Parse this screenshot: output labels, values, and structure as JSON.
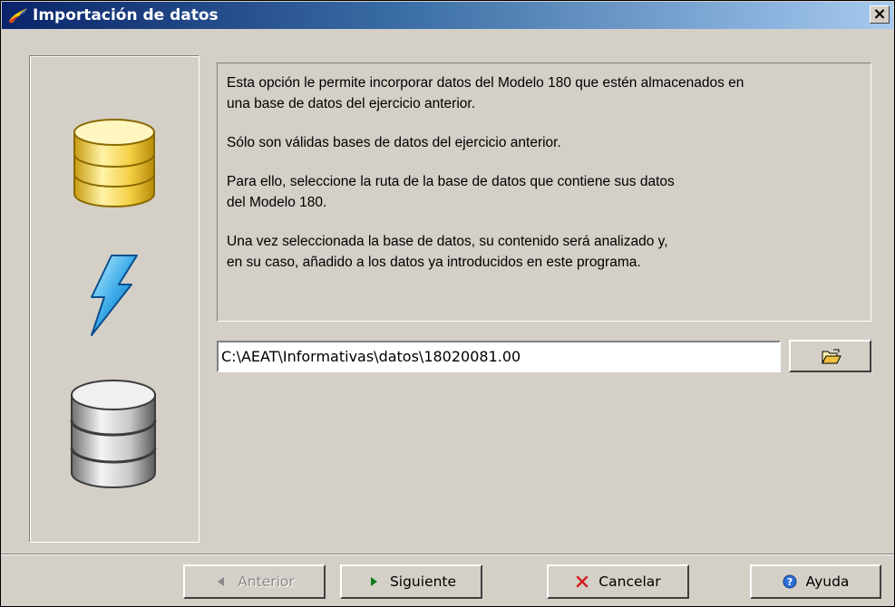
{
  "window": {
    "title": "Importación de datos",
    "close_glyph": "×"
  },
  "icons": {
    "title_icon": "brush-icon",
    "side": [
      "yellow-database-icon",
      "lightning-icon",
      "gray-database-icon"
    ],
    "browse": "open-folder-icon"
  },
  "info": {
    "paragraphs": [
      "Esta opción le permite incorporar datos del Modelo 180 que estén almacenados en\nuna base de datos del ejercicio anterior.",
      "Sólo son válidas bases de datos del ejercicio anterior.",
      "Para ello, seleccione la ruta de la base de datos que contiene sus datos\ndel Modelo 180.",
      "Una vez seleccionada la base de datos, su contenido será analizado y,\nen su caso, añadido a los datos ya introducidos en este programa."
    ]
  },
  "path": {
    "value": "C:\\AEAT\\Informativas\\datos\\18020081.00"
  },
  "buttons": {
    "back": {
      "label": "Anterior",
      "enabled": false
    },
    "next": {
      "label": "Siguiente",
      "enabled": true
    },
    "cancel": {
      "label": "Cancelar",
      "enabled": true
    },
    "help": {
      "label": "Ayuda",
      "enabled": true
    }
  },
  "colors": {
    "dialog_bg": "#d4d0c8",
    "title_start": "#0a246a",
    "title_end": "#a6caf0"
  }
}
